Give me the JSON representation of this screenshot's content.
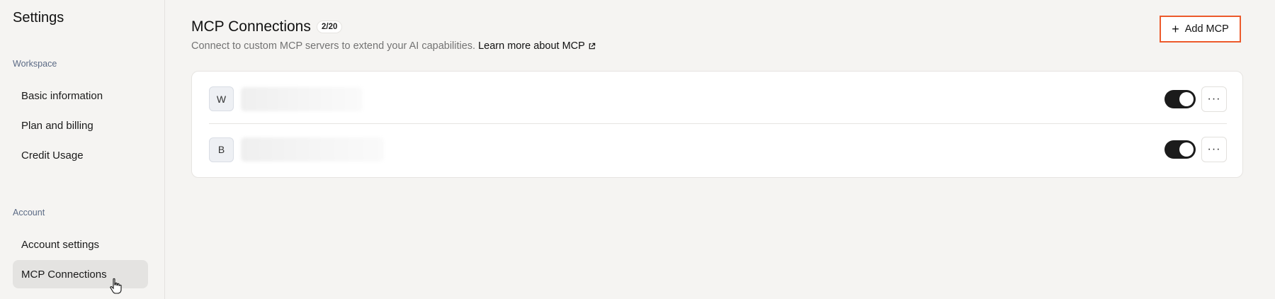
{
  "sidebar": {
    "title": "Settings",
    "sections": [
      {
        "label": "Workspace",
        "items": [
          {
            "label": "Basic information"
          },
          {
            "label": "Plan and billing"
          },
          {
            "label": "Credit Usage"
          }
        ]
      },
      {
        "label": "Account",
        "items": [
          {
            "label": "Account settings"
          },
          {
            "label": "MCP Connections",
            "active": true
          }
        ]
      }
    ]
  },
  "main": {
    "title": "MCP Connections",
    "count_badge": "2/20",
    "subtitle": "Connect to custom MCP servers to extend your AI capabilities.",
    "learn_more": "Learn more about MCP",
    "add_button": "Add MCP",
    "connections": [
      {
        "initial": "W",
        "enabled": true
      },
      {
        "initial": "B",
        "enabled": true
      }
    ],
    "more_icon_text": "···"
  },
  "colors": {
    "accent_outline": "#ec5a2c",
    "toggle_on": "#1b1b1b",
    "active_nav_bg": "#e4e3e1"
  },
  "icons": {
    "plus": "plus-icon",
    "external_link": "external-link-icon",
    "more": "more-horizontal-icon",
    "cursor": "hand-pointer-cursor-icon"
  }
}
